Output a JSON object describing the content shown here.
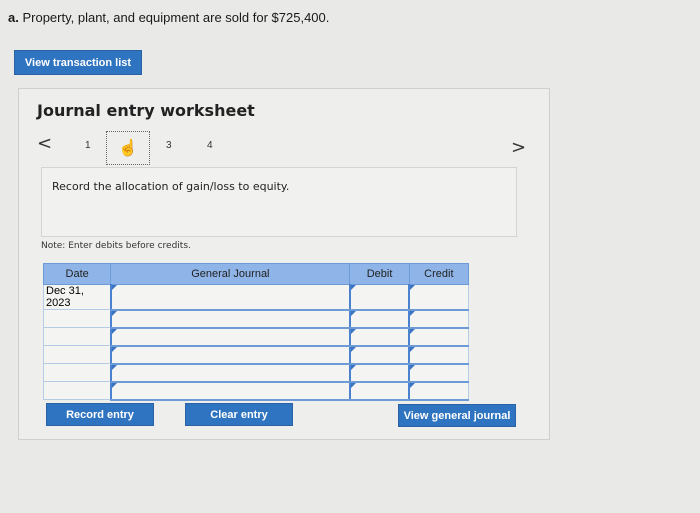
{
  "question": {
    "label": "a.",
    "text": "Property, plant, and equipment are sold for $725,400."
  },
  "buttons": {
    "view_transaction_list": "View transaction list",
    "record_entry": "Record entry",
    "clear_entry": "Clear entry",
    "view_general_journal": "View general journal"
  },
  "worksheet": {
    "title": "Journal entry worksheet",
    "nav": {
      "prev": "<",
      "next": ">"
    },
    "pages": [
      "1",
      "2",
      "3",
      "4"
    ],
    "active_page": "2",
    "instruction": "Record the allocation of gain/loss to equity.",
    "note": "Note: Enter debits before credits."
  },
  "journal": {
    "headers": {
      "date": "Date",
      "general_journal": "General Journal",
      "debit": "Debit",
      "credit": "Credit"
    },
    "rows": [
      {
        "date": "Dec 31, 2023",
        "account": "",
        "debit": "",
        "credit": ""
      },
      {
        "date": "",
        "account": "",
        "debit": "",
        "credit": ""
      },
      {
        "date": "",
        "account": "",
        "debit": "",
        "credit": ""
      },
      {
        "date": "",
        "account": "",
        "debit": "",
        "credit": ""
      },
      {
        "date": "",
        "account": "",
        "debit": "",
        "credit": ""
      },
      {
        "date": "",
        "account": "",
        "debit": "",
        "credit": ""
      }
    ]
  },
  "icons": {
    "active_page_icon": "hand-pointer-icon"
  },
  "colors": {
    "button_blue": "#2f74c0",
    "header_blue": "#8fb5e8"
  }
}
